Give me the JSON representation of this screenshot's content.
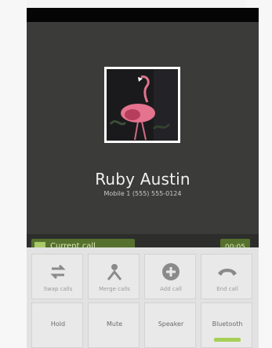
{
  "contact": {
    "name": "Ruby Austin",
    "number": "Mobile 1 (555) 555-0124"
  },
  "call": {
    "status": "Current call",
    "timer": "00:05"
  },
  "controls_top": [
    {
      "label": "Swap calls",
      "icon": "swap-icon"
    },
    {
      "label": "Merge calls",
      "icon": "merge-icon"
    },
    {
      "label": "Add call",
      "icon": "add-call-icon"
    },
    {
      "label": "End call",
      "icon": "end-call-icon"
    }
  ],
  "controls_bottom": [
    {
      "label": "Hold"
    },
    {
      "label": "Mute"
    },
    {
      "label": "Speaker"
    },
    {
      "label": "Bluetooth",
      "active": true
    }
  ],
  "colors": {
    "call_background": "#3b3c3a",
    "status_green": "#56702d",
    "bluetooth_active": "#a6cf55"
  }
}
